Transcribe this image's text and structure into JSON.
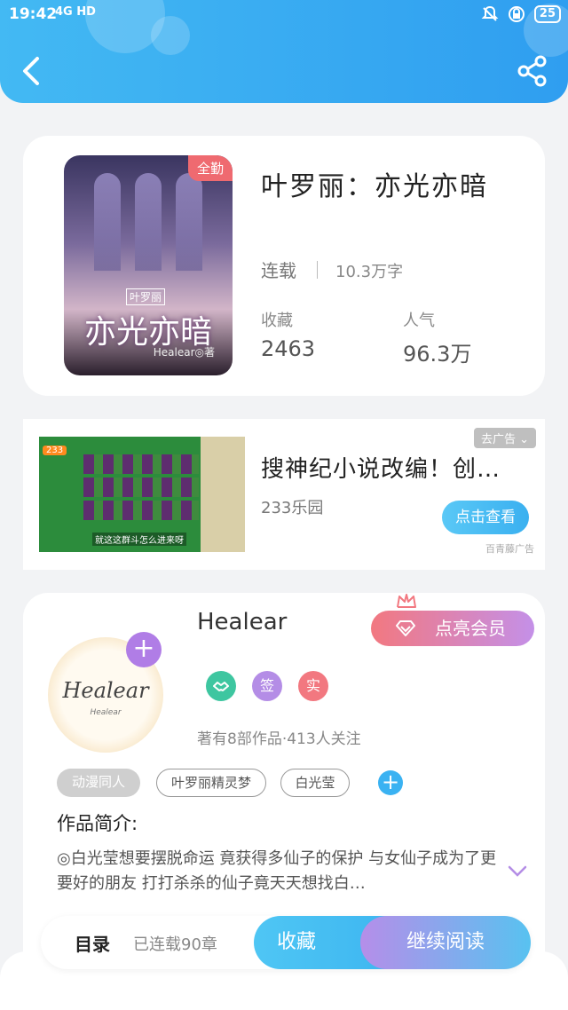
{
  "status_bar": {
    "time": "19:42",
    "network": "4G HD",
    "battery": "25"
  },
  "book": {
    "badge": "全勤",
    "title": "叶罗丽：亦光亦暗",
    "serial_status": "连载",
    "word_count": "10.3万字",
    "favorites_label": "收藏",
    "favorites_value": "2463",
    "popularity_label": "人气",
    "popularity_value": "96.3万",
    "cover": {
      "title": "亦光亦暗",
      "series": "叶罗丽",
      "author": "Healear◎著"
    }
  },
  "ad": {
    "close_label": "去广告",
    "title": "搜神纪小说改编！创…",
    "source": "233乐园",
    "button": "点击查看",
    "note": "百青藤广告",
    "image_tag": "233",
    "image_caption": "就这这群斗怎么进来呀"
  },
  "author": {
    "name": "Healear",
    "vip_button": "点亮会员",
    "signature": "Healear",
    "medals": [
      "签",
      "实"
    ],
    "works_info": "著有8部作品·413人关注",
    "tags": [
      "动漫同人",
      "叶罗丽精灵梦",
      "白光莹"
    ],
    "intro_label": "作品简介:",
    "intro_text": "◎白光莹想要摆脱命运 竟获得多仙子的保护 与女仙子成为了更要好的朋友 打打杀杀的仙子竟天天想找白…"
  },
  "bottom_bar": {
    "toc": "目录",
    "chapters": "已连载90章",
    "collect": "收藏",
    "read": "继续阅读"
  },
  "colors": {
    "header_blue": "#2f9ef0",
    "badge_red": "#ef6a70",
    "vip_gradient_start": "#f27880",
    "vip_gradient_end": "#c490e8",
    "accent_blue": "#3ab2f2",
    "purple": "#b07de6"
  }
}
